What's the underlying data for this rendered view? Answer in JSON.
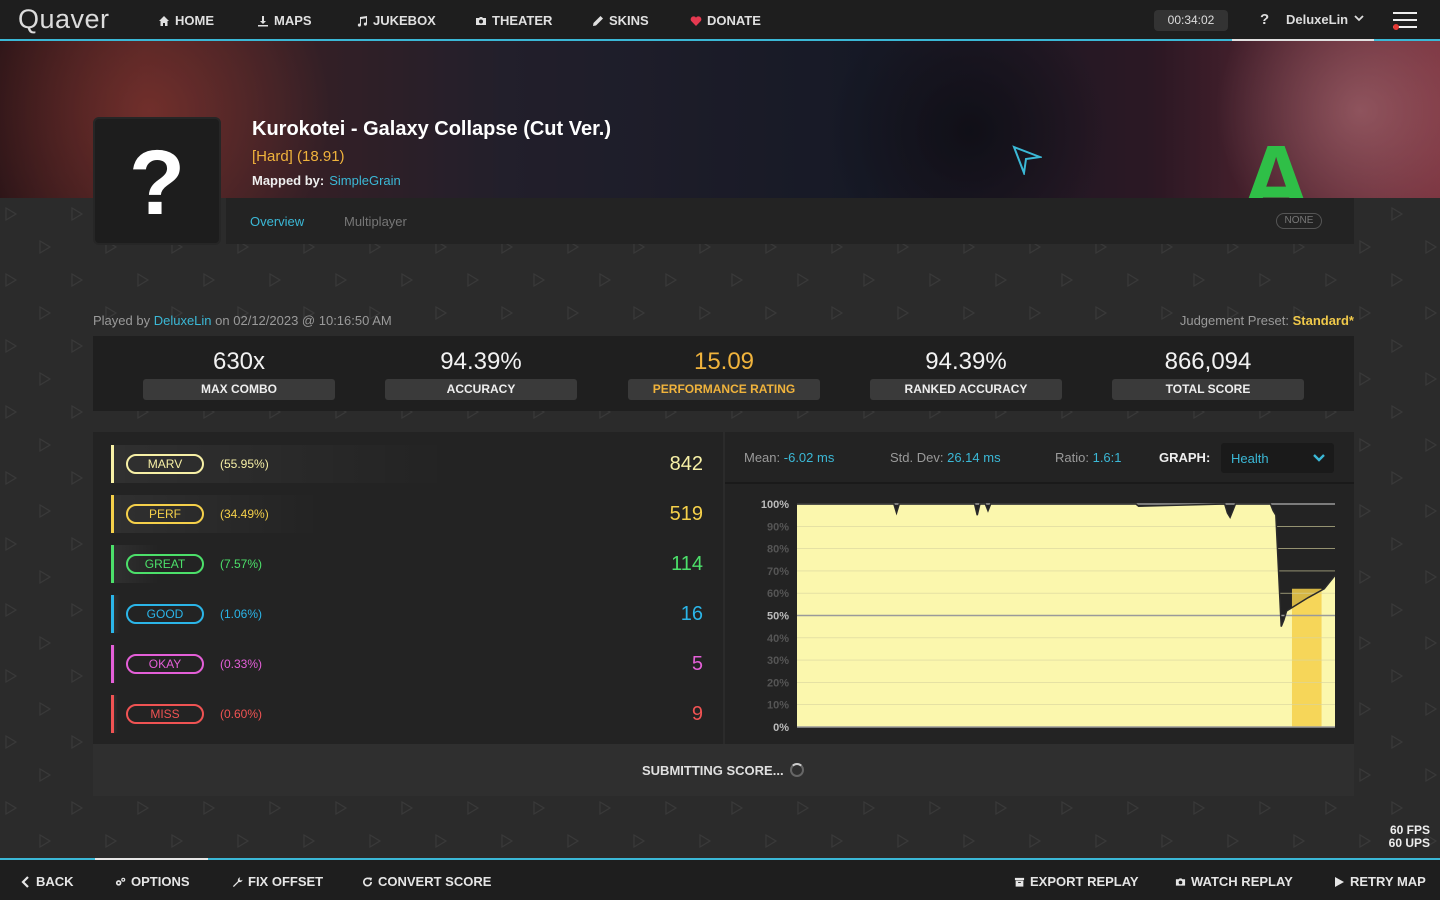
{
  "app": {
    "logo": "Quaver"
  },
  "nav": {
    "items": [
      {
        "label": "HOME",
        "icon": "home-icon"
      },
      {
        "label": "MAPS",
        "icon": "download-icon"
      },
      {
        "label": "JUKEBOX",
        "icon": "music-note-icon"
      },
      {
        "label": "THEATER",
        "icon": "camera-icon"
      },
      {
        "label": "SKINS",
        "icon": "pencil-icon"
      },
      {
        "label": "DONATE",
        "icon": "heart-icon"
      }
    ],
    "clock": "00:34:02",
    "help": "?",
    "username": "DeluxeLin"
  },
  "map": {
    "title": "Kurokotei - Galaxy Collapse (Cut Ver.)",
    "difficulty": "[Hard] (18.91)",
    "mapped_by_label": "Mapped by:",
    "mapper": "SimpleGrain",
    "cover_placeholder": "?",
    "grade": "A"
  },
  "tabs": {
    "overview": "Overview",
    "multiplayer": "Multiplayer",
    "mods": "NONE"
  },
  "play": {
    "played_by_label": "Played by",
    "player": "DeluxeLin",
    "date_text": "on 02/12/2023 @ 10:16:50 AM",
    "judgement_label": "Judgement Preset:",
    "judgement_value": "Standard*"
  },
  "stats": {
    "max_combo": {
      "value": "630x",
      "label": "MAX COMBO"
    },
    "accuracy": {
      "value": "94.39%",
      "label": "ACCURACY"
    },
    "performance": {
      "value": "15.09",
      "label": "PERFORMANCE RATING"
    },
    "ranked_accuracy": {
      "value": "94.39%",
      "label": "RANKED ACCURACY"
    },
    "total_score": {
      "value": "866,094",
      "label": "TOTAL SCORE"
    }
  },
  "judgements": [
    {
      "name": "MARV",
      "pct": "(55.95%)",
      "count": "842",
      "color": "#f7f0a6"
    },
    {
      "name": "PERF",
      "pct": "(34.49%)",
      "count": "519",
      "color": "#f5d04a"
    },
    {
      "name": "GREAT",
      "pct": "(7.57%)",
      "count": "114",
      "color": "#4ce06a"
    },
    {
      "name": "GOOD",
      "pct": "(1.06%)",
      "count": "16",
      "color": "#2bb5e8"
    },
    {
      "name": "OKAY",
      "pct": "(0.33%)",
      "count": "5",
      "color": "#e45fd8"
    },
    {
      "name": "MISS",
      "pct": "(0.60%)",
      "count": "9",
      "color": "#f05353"
    }
  ],
  "graph": {
    "mean_label": "Mean:",
    "mean_value": "-6.02 ms",
    "std_label": "Std. Dev:",
    "std_value": "26.14 ms",
    "ratio_label": "Ratio:",
    "ratio_value": "1.6:1",
    "graph_label": "GRAPH:",
    "selected": "Health",
    "y_ticks": [
      "100%",
      "90%",
      "80%",
      "70%",
      "60%",
      "50%",
      "40%",
      "30%",
      "20%",
      "10%",
      "0%"
    ]
  },
  "chart_data": {
    "type": "area",
    "ylim": [
      0,
      100
    ],
    "y_tick_labels": [
      "100%",
      "90%",
      "80%",
      "70%",
      "60%",
      "50%",
      "40%",
      "30%",
      "20%",
      "10%",
      "0%"
    ],
    "x": [
      0,
      0.18,
      0.185,
      0.19,
      0.33,
      0.335,
      0.34,
      0.35,
      0.355,
      0.36,
      0.63,
      0.635,
      0.795,
      0.8,
      0.805,
      0.81,
      0.815,
      0.88,
      0.885,
      0.89,
      0.9,
      0.905,
      0.91,
      0.95,
      0.98,
      1.0
    ],
    "values": [
      100,
      100,
      96,
      100,
      100,
      95,
      100,
      100,
      97,
      100,
      100,
      99,
      100,
      96,
      94,
      97,
      100,
      100,
      97,
      95,
      45,
      48,
      52,
      58,
      62,
      68
    ]
  },
  "submit": {
    "text": "SUBMITTING SCORE..."
  },
  "fps": {
    "fps": "60 FPS",
    "ups": "60 UPS"
  },
  "bottom": {
    "back": "BACK",
    "options": "OPTIONS",
    "fix_offset": "FIX OFFSET",
    "convert": "CONVERT SCORE",
    "export": "EXPORT REPLAY",
    "watch": "WATCH REPLAY",
    "retry": "RETRY MAP"
  }
}
